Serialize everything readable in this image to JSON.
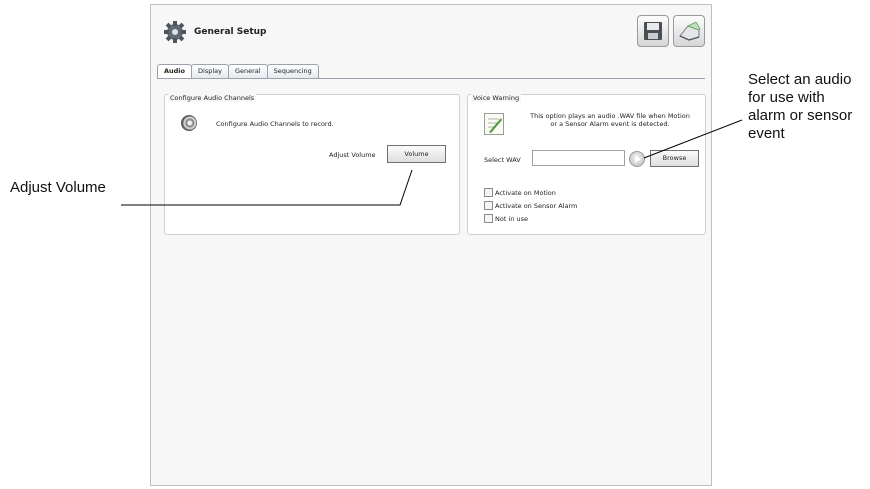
{
  "window": {
    "title": "General Setup",
    "icons": {
      "app": "gear-icon",
      "save": "floppy-disk-icon",
      "scan": "scanner-icon"
    },
    "tabs": [
      {
        "label": "Audio",
        "active": true
      },
      {
        "label": "Display",
        "active": false
      },
      {
        "label": "General",
        "active": false
      },
      {
        "label": "Sequencing",
        "active": false
      }
    ]
  },
  "audio_channels": {
    "group_title": "Configure Audio Channels",
    "icon": "speaker-icon",
    "description": "Configure Audio Channels to record.",
    "adjust_label": "Adjust Volume",
    "volume_button": "Volume"
  },
  "voice_warning": {
    "group_title": "Voice Warning",
    "icon": "notepad-icon",
    "description_line1": "This option plays an audio .WAV file when Motion",
    "description_line2": "or a Sensor Alarm event is detected.",
    "select_wav_label": "Select WAV",
    "wav_value": "",
    "play_icon": "play-icon",
    "browse_button": "Browse",
    "checkboxes": [
      {
        "label": "Activate on Motion",
        "checked": false
      },
      {
        "label": "Activate on Sensor Alarm",
        "checked": false
      },
      {
        "label": "Not in use",
        "checked": false
      }
    ]
  },
  "annotations": {
    "left": "Adjust Volume",
    "right_line1": "Select an audio",
    "right_line2": "for use with",
    "right_line3": "alarm or sensor",
    "right_line4": "event"
  }
}
